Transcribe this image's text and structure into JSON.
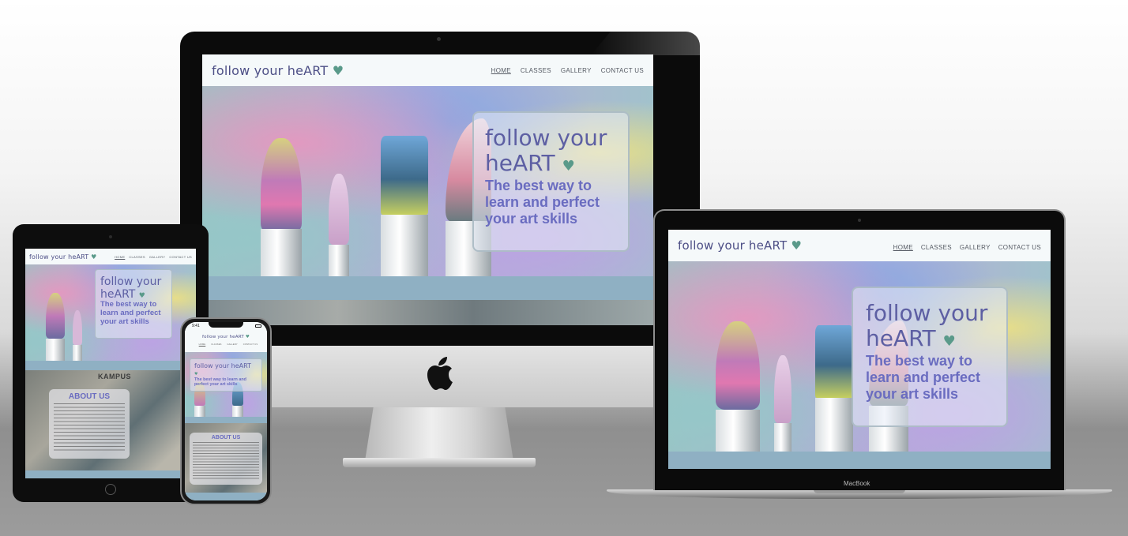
{
  "site": {
    "logo": "follow your heART",
    "leaf_glyph": "♥",
    "nav": {
      "home": "HOME",
      "classes": "CLASSES",
      "gallery": "GALLERY",
      "contact": "CONTACT US"
    },
    "hero": {
      "title_line1": "follow your",
      "title_line2": "heART",
      "subtitle_line1": "The best way to",
      "subtitle_line2": "learn and perfect",
      "subtitle_line3": "your art skills",
      "subtitle_full": "The best way to learn and perfect your art skills"
    },
    "about": {
      "title": "ABOUT US"
    }
  },
  "devices": {
    "laptop_label": "MacBook",
    "phone_time": "9:41",
    "tablet_photo_sign": "KAMPUS"
  },
  "colors": {
    "logo": "#4d4f86",
    "hero_text": "#6a6cc0",
    "band": "#8fb0c3"
  }
}
